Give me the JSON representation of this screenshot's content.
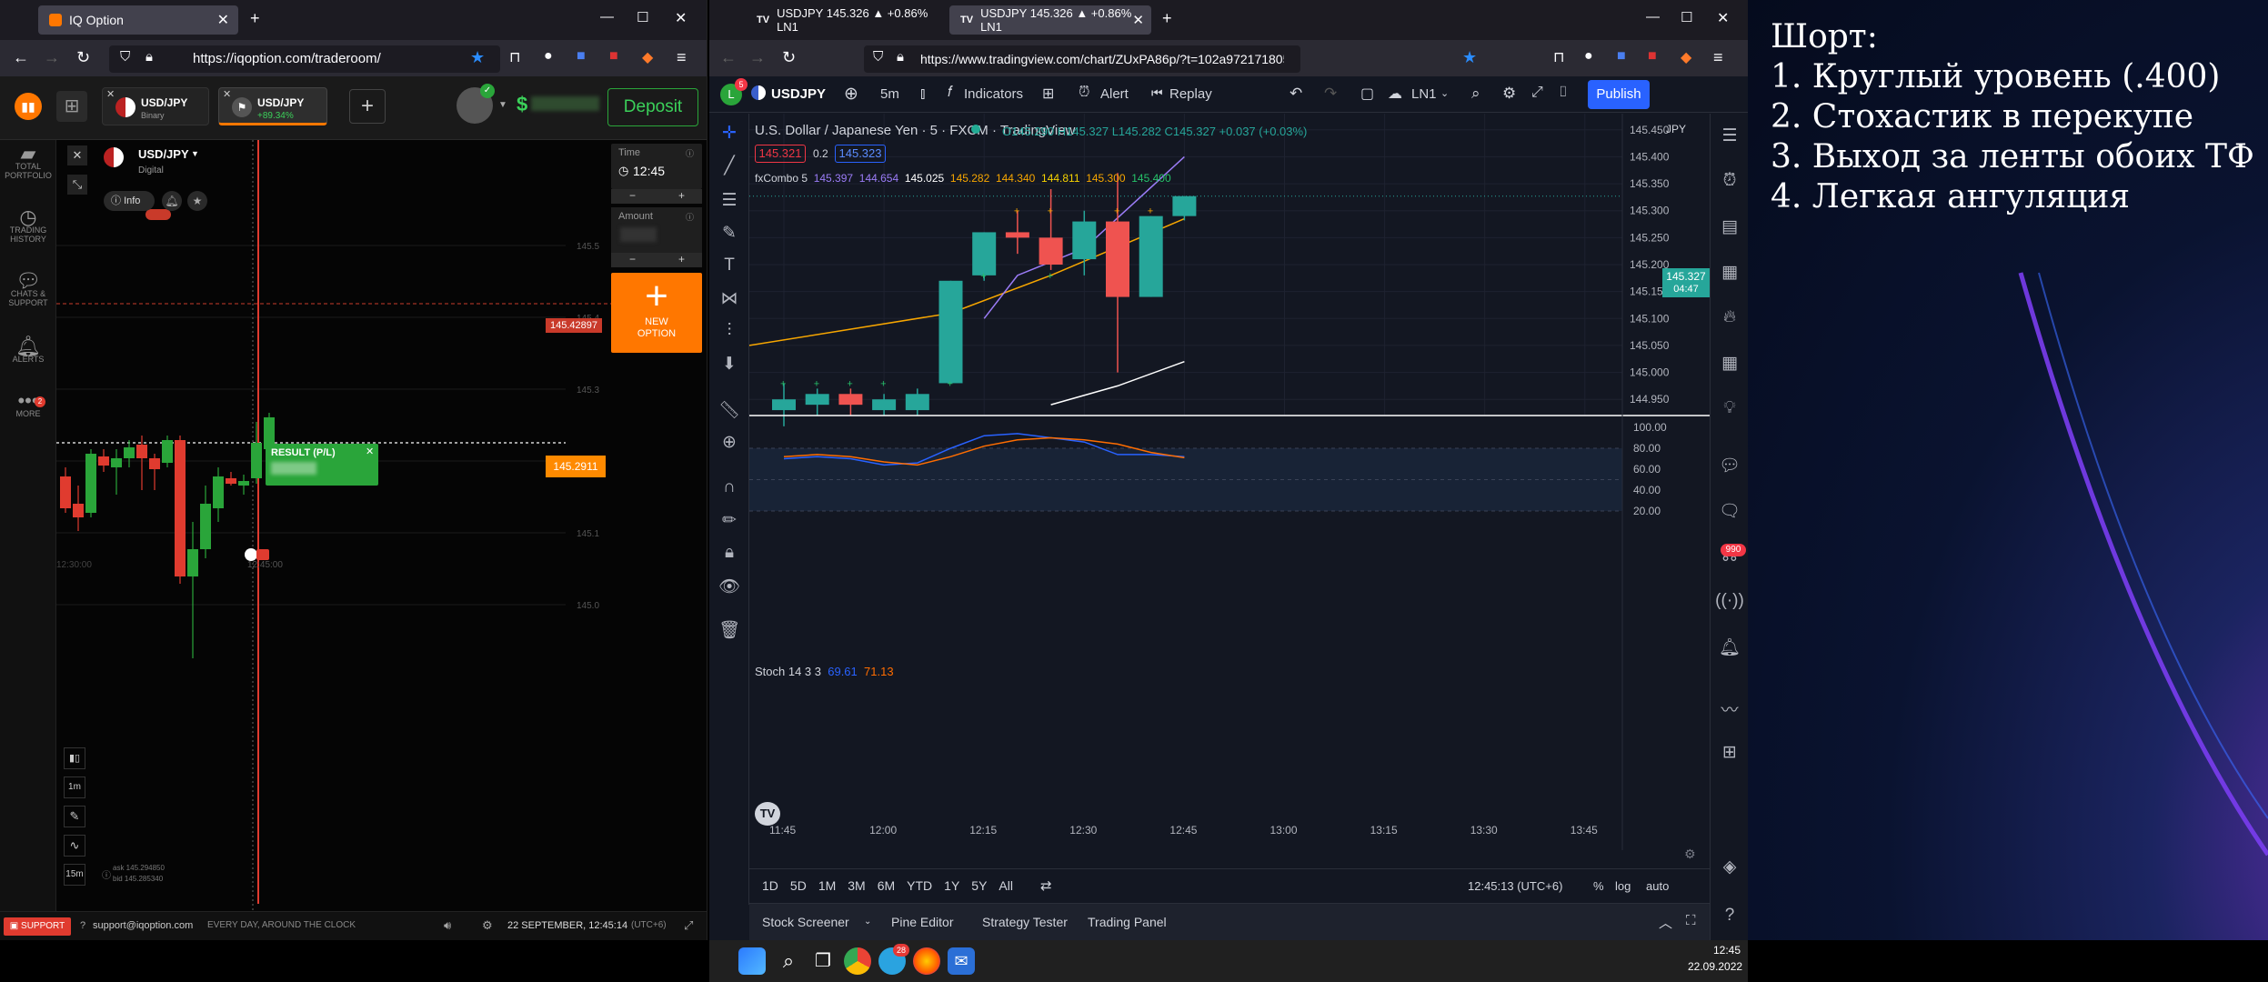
{
  "left_browser": {
    "tabs": [
      {
        "title": "IQ Option"
      }
    ],
    "url": "https://iqoption.com/traderoom/",
    "assets": [
      {
        "name": "USD/JPY",
        "sub": "Binary"
      },
      {
        "name": "USD/JPY",
        "sub": "+89.34%"
      }
    ],
    "deposit_label": "Deposit",
    "balance_prefix": "$",
    "sidebar": [
      {
        "icon": "portfolio-icon",
        "label": "TOTAL\nPORTFOLIO"
      },
      {
        "icon": "history-icon",
        "label": "TRADING\nHISTORY"
      },
      {
        "icon": "chat-icon",
        "label": "CHATS &\nSUPPORT"
      },
      {
        "icon": "bell-icon",
        "label": "ALERTS"
      },
      {
        "icon": "more-icon",
        "label": "MORE",
        "badge": "2"
      }
    ],
    "instrument": {
      "name": "USD/JPY",
      "type": "Digital"
    },
    "info_label": "Info",
    "time": {
      "label": "Time",
      "value": "12:45"
    },
    "amount": {
      "label": "Amount"
    },
    "new_option": "NEW\nOPTION",
    "price_tag_red": "145.42897",
    "price_tag_orange": "145.2911",
    "result_label": "RESULT (P/L)",
    "price_levels": [
      "145.5",
      "145.4",
      "145.3",
      "145.2",
      "145.1",
      "145.0"
    ],
    "time_labels": [
      "12:30:00",
      "12:45:00"
    ],
    "tools": [
      "1m",
      "15m"
    ],
    "ask": "ask 145.294850",
    "bid": "bid 145.285340",
    "support_label": "SUPPORT",
    "support_email": "support@iqoption.com",
    "support_hours": "EVERY DAY, AROUND THE CLOCK",
    "datetime": "22 SEPTEMBER, 12:45:14",
    "timezone": "(UTC+6)"
  },
  "right_browser": {
    "tabs": [
      {
        "title": "USDJPY 145.326 ▲ +0.86% LN1"
      },
      {
        "title": "USDJPY 145.326 ▲ +0.86% LN1"
      }
    ],
    "url": "https://www.tradingview.com/chart/ZUxPA86p/?t=102a97217180509614fd03637f4d3%3",
    "toolbar": {
      "symbol": "USDJPY",
      "interval": "5m",
      "indicators": "Indicators",
      "alert": "Alert",
      "replay": "Replay",
      "layout": "LN1",
      "publish": "Publish",
      "avatar_letter": "L",
      "avatar_badge": "5"
    },
    "legend": {
      "title": "U.S. Dollar / Japanese Yen · 5 · FXCM · TradingView",
      "ohlc": "O145.290 H145.327 L145.282 C145.327 +0.037 (+0.03%)",
      "bid": "145.321",
      "spread": "0.2",
      "ask": "145.323",
      "indicator_name": "fxCombo 5",
      "indicator_values": [
        "145.397",
        "144.654",
        "145.025",
        "145.282",
        "144.340",
        "144.811",
        "145.300",
        "145.400"
      ]
    },
    "price_axis": {
      "currency": "JPY",
      "ticks": [
        "145.450",
        "145.400",
        "145.350",
        "145.300",
        "145.250",
        "145.200",
        "145.150",
        "145.100",
        "145.050",
        "145.000",
        "144.950"
      ],
      "last_price": "145.327",
      "countdown": "04:47"
    },
    "stoch": {
      "label": "Stoch 14 3 3",
      "k": "69.61",
      "d": "71.13",
      "ticks": [
        "100.00",
        "80.00",
        "60.00",
        "40.00",
        "20.00"
      ]
    },
    "time_axis": [
      "11:45",
      "12:00",
      "12:15",
      "12:30",
      "12:45",
      "13:00",
      "13:15",
      "13:30",
      "13:45"
    ],
    "ranges": [
      "1D",
      "5D",
      "1M",
      "3M",
      "6M",
      "YTD",
      "1Y",
      "5Y",
      "All"
    ],
    "clock": "12:45:13 (UTC+6)",
    "scale_opts": [
      "%",
      "log",
      "auto"
    ],
    "bottom_tabs": [
      "Stock Screener",
      "Pine Editor",
      "Strategy Tester",
      "Trading Panel"
    ],
    "right_badge": "990"
  },
  "chart_data": {
    "type": "candlestick",
    "timeframe": "5m",
    "ylim": [
      144.92,
      145.48
    ],
    "candles": [
      {
        "t": "11:45",
        "o": 144.93,
        "h": 144.98,
        "l": 144.9,
        "c": 144.95
      },
      {
        "t": "11:50",
        "o": 144.94,
        "h": 144.97,
        "l": 144.92,
        "c": 144.96
      },
      {
        "t": "11:55",
        "o": 144.96,
        "h": 144.97,
        "l": 144.92,
        "c": 144.94
      },
      {
        "t": "12:00",
        "o": 144.93,
        "h": 144.96,
        "l": 144.92,
        "c": 144.95
      },
      {
        "t": "12:05",
        "o": 144.93,
        "h": 144.97,
        "l": 144.92,
        "c": 144.96
      },
      {
        "t": "12:10",
        "o": 144.98,
        "h": 145.17,
        "l": 144.98,
        "c": 145.17
      },
      {
        "t": "12:15",
        "o": 145.18,
        "h": 145.26,
        "l": 145.17,
        "c": 145.26
      },
      {
        "t": "12:20",
        "o": 145.26,
        "h": 145.3,
        "l": 145.22,
        "c": 145.25
      },
      {
        "t": "12:25",
        "o": 145.25,
        "h": 145.34,
        "l": 145.19,
        "c": 145.2
      },
      {
        "t": "12:30",
        "o": 145.21,
        "h": 145.3,
        "l": 145.18,
        "c": 145.28
      },
      {
        "t": "12:35",
        "o": 145.28,
        "h": 145.37,
        "l": 145.0,
        "c": 145.14
      },
      {
        "t": "12:40",
        "o": 145.14,
        "h": 145.29,
        "l": 145.14,
        "c": 145.29
      },
      {
        "t": "12:45",
        "o": 145.29,
        "h": 145.327,
        "l": 145.282,
        "c": 145.327
      }
    ],
    "stoch_k": [
      70,
      72,
      70,
      64,
      66,
      80,
      92,
      94,
      90,
      86,
      74,
      74,
      72
    ],
    "stoch_d": [
      72,
      74,
      72,
      67,
      64,
      72,
      82,
      88,
      90,
      88,
      84,
      76,
      71
    ]
  },
  "notes": {
    "lines": [
      "Шорт:",
      "1. Круглый уровень (.400)",
      "2. Стохастик в перекупе",
      "3. Выход за ленты обоих ТФ",
      "4. Легкая ангуляция"
    ]
  },
  "taskbar": {
    "time": "12:45",
    "date": "22.09.2022",
    "telegram_badge": "28"
  },
  "colors": {
    "up": "#26a69a",
    "down": "#ef5350",
    "iq_green": "#2aa53a",
    "iq_red": "#e03b2f",
    "iq_orange": "#ff7700",
    "tv_blue": "#2962ff"
  }
}
